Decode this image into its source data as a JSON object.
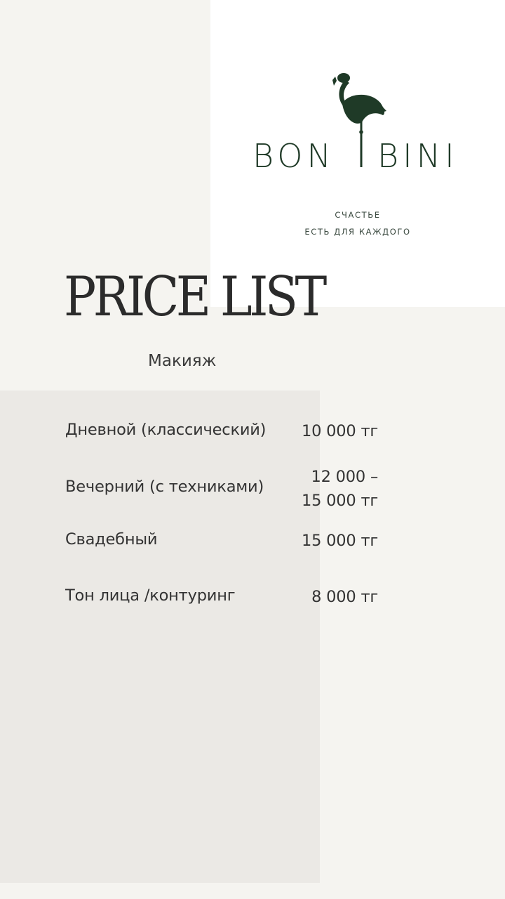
{
  "brand": {
    "logo_text": "BON BINI",
    "tagline_line1": "СЧАСТЬЕ",
    "tagline_line2": "ЕСТЬ ДЛЯ КАЖДОГО",
    "color": "#1f3a27"
  },
  "title": "PRICE LIST",
  "section": "Макияж",
  "items": [
    {
      "name": "Дневной (классический)",
      "price_lines": [
        "10 000 тг"
      ]
    },
    {
      "name": "Вечерний (с техниками)",
      "price_lines": [
        "12 000 –",
        "15 000 тг"
      ]
    },
    {
      "name": "Свадебный",
      "price_lines": [
        "15 000 тг"
      ]
    },
    {
      "name": "Тон лица /контуринг",
      "price_lines": [
        "8 000 тг"
      ]
    }
  ],
  "colors": {
    "background": "#f5f4f0",
    "panel_grey": "#ebe9e5",
    "card_white": "#ffffff",
    "text": "#2f2f2f"
  }
}
